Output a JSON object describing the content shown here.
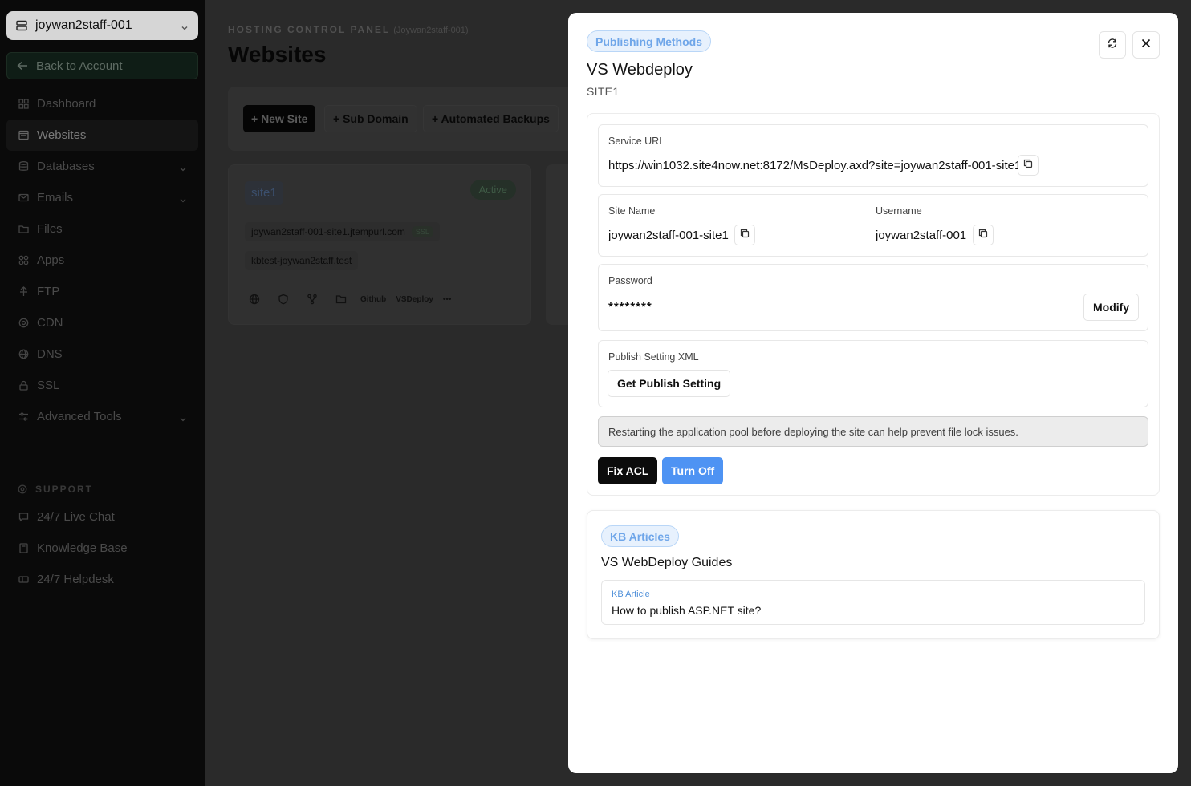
{
  "sidebar": {
    "account": "joywan2staff-001",
    "back": "Back to Account",
    "items": [
      {
        "label": "Dashboard",
        "icon": "grid-icon"
      },
      {
        "label": "Websites",
        "icon": "browser-icon"
      },
      {
        "label": "Databases",
        "icon": "database-icon"
      },
      {
        "label": "Emails",
        "icon": "mail-icon"
      },
      {
        "label": "Files",
        "icon": "folder-icon"
      },
      {
        "label": "Apps",
        "icon": "apps-icon"
      },
      {
        "label": "FTP",
        "icon": "ftp-icon"
      },
      {
        "label": "CDN",
        "icon": "cdn-icon"
      },
      {
        "label": "DNS",
        "icon": "globe-icon"
      },
      {
        "label": "SSL",
        "icon": "lock-icon"
      },
      {
        "label": "Advanced Tools",
        "icon": "sliders-icon"
      }
    ],
    "support_heading": "SUPPORT",
    "support_items": [
      {
        "label": "24/7 Live Chat",
        "icon": "chat-icon"
      },
      {
        "label": "Knowledge Base",
        "icon": "book-icon"
      },
      {
        "label": "24/7 Helpdesk",
        "icon": "ticket-icon"
      }
    ]
  },
  "main": {
    "crumb": "HOSTING CONTROL PANEL",
    "crumb_sub": "(Joywan2staff-001)",
    "title": "Websites",
    "toolbar": {
      "new_site": "+ New Site",
      "sub_domain": "+ Sub Domain",
      "backups": "+ Automated Backups"
    },
    "site": {
      "name": "site1",
      "status": "Active",
      "domain1": "joywan2staff-001-site1.jtempurl.com",
      "ssl": "SSL",
      "domain2": "kbtest-joywan2staff.test",
      "github": "Github",
      "vsdeploy": "VSDeploy",
      "more": "•••"
    }
  },
  "modal": {
    "badge": "Publishing Methods",
    "title": "VS Webdeploy",
    "subtitle": "SITE1",
    "service_url_label": "Service URL",
    "service_url": "https://win1032.site4now.net:8172/MsDeploy.axd?site=joywan2staff-001-site1",
    "site_name_label": "Site Name",
    "site_name": "joywan2staff-001-site1",
    "username_label": "Username",
    "username": "joywan2staff-001",
    "password_label": "Password",
    "password": "********",
    "modify": "Modify",
    "publish_label": "Publish Setting XML",
    "get_publish": "Get Publish Setting",
    "notice": "Restarting the application pool before deploying the site can help prevent file lock issues.",
    "fix_acl": "Fix ACL",
    "turn_off": "Turn Off",
    "kb": {
      "badge": "KB Articles",
      "title": "VS WebDeploy Guides",
      "item_tag": "KB Article",
      "item_title": "How to publish ASP.NET site?"
    }
  },
  "colors": {
    "accent_blue": "#4e93f3",
    "badge_text": "#6fa6e9",
    "badge_bg": "#e7f1fd"
  }
}
